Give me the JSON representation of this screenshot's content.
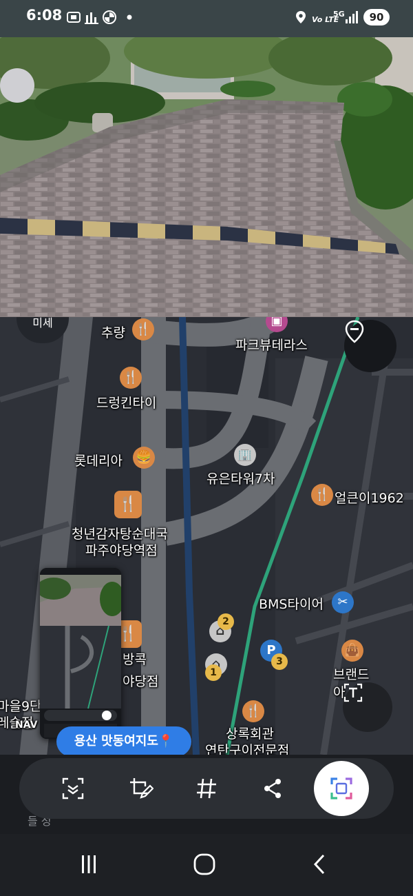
{
  "status_bar": {
    "time": "6:08",
    "network_label": "Vo LTE",
    "network_gen": "5G",
    "battery": "90",
    "icons": [
      "screenshot-icon",
      "chart-icon",
      "bmw-icon",
      "dot-icon",
      "location-icon",
      "signal-icon"
    ]
  },
  "photo": {
    "description_icon": "photo-street-icon"
  },
  "map": {
    "chip_label": "미세",
    "pois": [
      {
        "label": "추량"
      },
      {
        "label": "파크뷰테라스"
      },
      {
        "label": "드렁킨타이"
      },
      {
        "label": "롯데리아"
      },
      {
        "label": "유은타워7차"
      },
      {
        "label": "얼큰이1962"
      },
      {
        "label": "청년감자탕순대국"
      },
      {
        "label": "파주야당역점"
      },
      {
        "label": "BMS타이어"
      },
      {
        "label": "방콕"
      },
      {
        "label": "야당점"
      },
      {
        "label": "브랜드"
      },
      {
        "label": "아"
      },
      {
        "label": "마을9단"
      },
      {
        "label": "레슬점"
      },
      {
        "label": "NAV"
      },
      {
        "label": "상록회관"
      },
      {
        "label": "연탄구이전문점"
      }
    ],
    "markers": {
      "one": "1",
      "two": "2",
      "three": "3",
      "parking": "P"
    },
    "banner": "용산 맛동여지도📍",
    "accent": "#2ea37a"
  },
  "toolbar": {
    "items": [
      "scan-icon",
      "edit-crop-icon",
      "hashtag-icon",
      "share-icon",
      "capture-icon"
    ],
    "hidden_text": "들                                                                      성"
  },
  "navbar": {
    "items": [
      "recents-icon",
      "home-icon",
      "back-icon"
    ]
  }
}
